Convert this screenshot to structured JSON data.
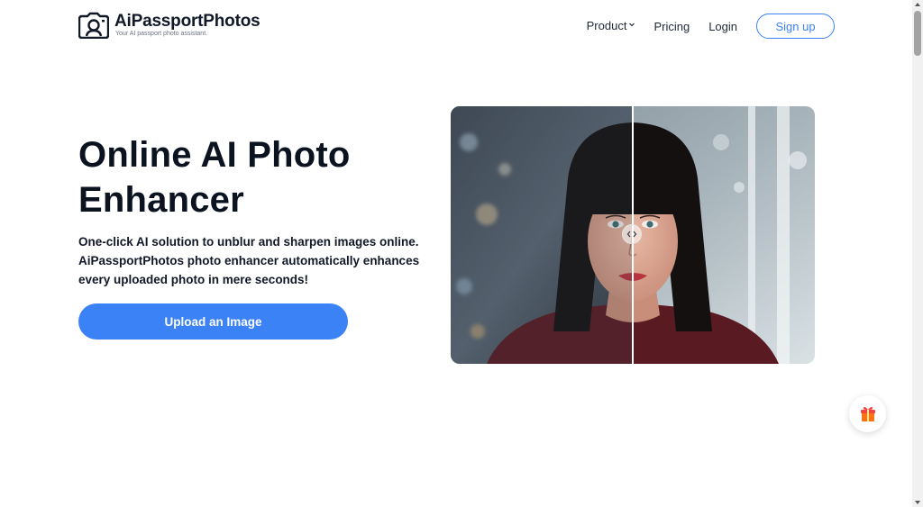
{
  "brand": {
    "name": "AiPassportPhotos",
    "tagline": "Your AI passport photo assistant."
  },
  "nav": {
    "product": "Product",
    "pricing": "Pricing",
    "login": "Login",
    "signup": "Sign up"
  },
  "hero": {
    "title": "Online AI Photo Enhancer",
    "subtitle": "One-click AI solution to unblur and sharpen images online. AiPassportPhotos photo enhancer automatically enhances every uploaded photo in mere seconds!",
    "cta": "Upload an Image"
  },
  "compare": {
    "handle_glyph": "‹›",
    "split_fraction": 0.5
  },
  "icons": {
    "logo": "camera-portrait-icon",
    "product_dropdown": "chevron-down-icon",
    "gift": "gift-icon",
    "compare_handle": "left-right-arrows-icon"
  },
  "colors": {
    "accent": "#3b82f6",
    "text": "#0b1220",
    "gift": "#f97316"
  }
}
